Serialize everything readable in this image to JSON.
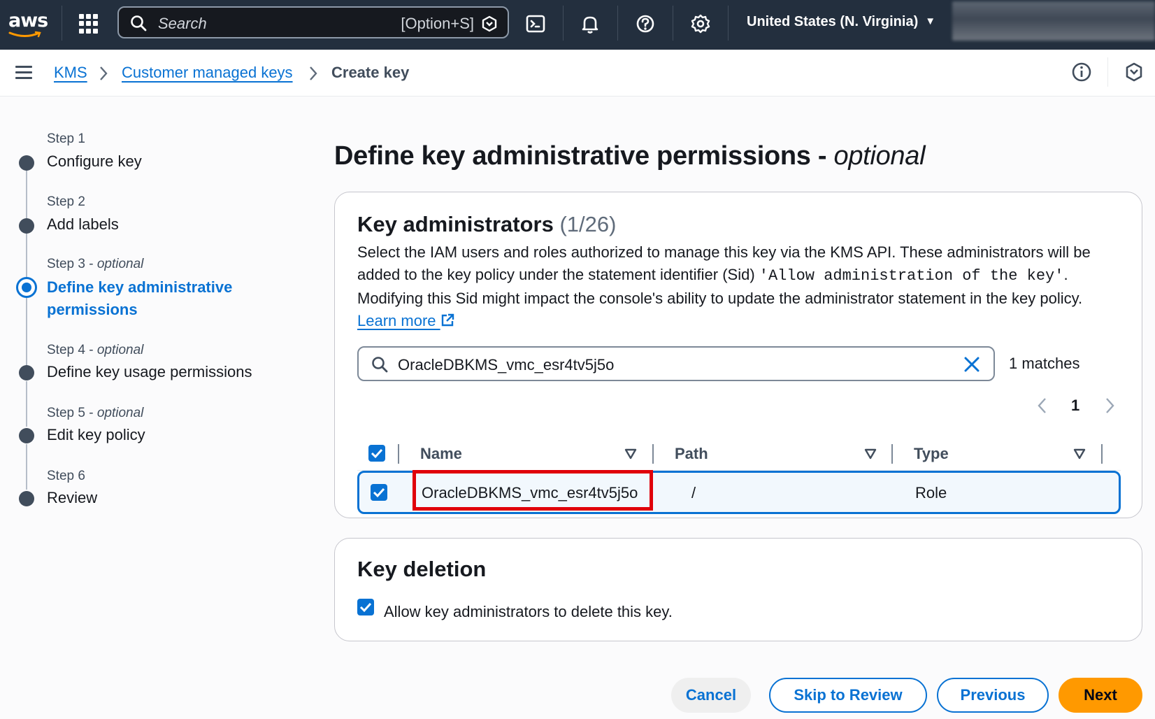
{
  "topnav": {
    "logo": "aws",
    "search_placeholder": "Search",
    "search_shortcut": "[Option+S]",
    "region": "United States (N. Virginia)",
    "icons": [
      "apps-grid-icon",
      "search-icon",
      "amazon-q-icon",
      "cloudshell-icon",
      "bell-icon",
      "help-icon",
      "gear-icon",
      "caret-down-icon"
    ]
  },
  "breadcrumb": {
    "items": [
      "KMS",
      "Customer managed keys"
    ],
    "current": "Create key"
  },
  "steps": [
    {
      "label": "Step 1",
      "optional": "",
      "name": "Configure key",
      "active": false
    },
    {
      "label": "Step 2",
      "optional": "",
      "name": "Add labels",
      "active": false
    },
    {
      "label": "Step 3 - ",
      "optional": "optional",
      "name_line1": "Define key administrative",
      "name_line2": "permissions",
      "active": true
    },
    {
      "label": "Step 4 - ",
      "optional": "optional",
      "name": "Define key usage permissions",
      "active": false
    },
    {
      "label": "Step 5 - ",
      "optional": "optional",
      "name": "Edit key policy",
      "active": false
    },
    {
      "label": "Step 6",
      "optional": "",
      "name": "Review",
      "active": false
    }
  ],
  "page": {
    "title": "Define key administrative permissions - ",
    "title_optional": "optional"
  },
  "admins_panel": {
    "title": "Key administrators",
    "count": "(1/26)",
    "desc_part1": "Select the IAM users and roles authorized to manage this key via the KMS API. These administrators will be added to the key policy under the statement identifier (Sid) ",
    "desc_code": "'Allow administration of the key'",
    "desc_part2": ". Modifying this Sid might impact the console's ability to update the administrator statement in the key policy. ",
    "learn_more": "Learn more",
    "filter_value": "OracleDBKMS_vmc_esr4tv5j5o",
    "matches": "1 matches",
    "page": "1",
    "columns": [
      "Name",
      "Path",
      "Type"
    ],
    "rows": [
      {
        "name": "OracleDBKMS_vmc_esr4tv5j5o",
        "path": "/",
        "type": "Role",
        "selected": true
      }
    ]
  },
  "deletion_panel": {
    "title": "Key deletion",
    "checkbox_label": "Allow key administrators to delete this key.",
    "checked": true
  },
  "footer": {
    "cancel": "Cancel",
    "skip": "Skip to Review",
    "previous": "Previous",
    "next": "Next"
  },
  "colors": {
    "nav_bg": "#232f3e",
    "link_blue": "#0972d3",
    "primary_orange": "#ff9900",
    "highlight_red": "#e0000a"
  }
}
